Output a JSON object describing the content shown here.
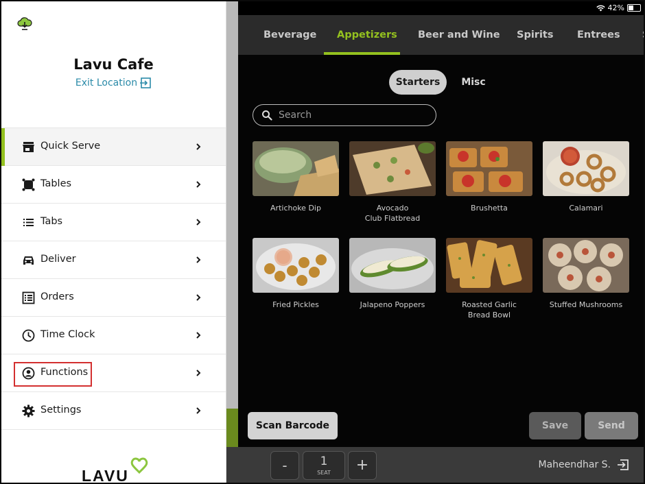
{
  "status": {
    "battery": "42%"
  },
  "categories": [
    "Beverage",
    "Appetizers",
    "Beer and Wine",
    "Spirits",
    "Entrees",
    "S"
  ],
  "active_category": "Appetizers",
  "subtabs": {
    "starters": "Starters",
    "misc": "Misc"
  },
  "search": {
    "placeholder": "Search"
  },
  "items": [
    {
      "line1": "Artichoke Dip",
      "line2": ""
    },
    {
      "line1": "Avocado",
      "line2": "Club Flatbread"
    },
    {
      "line1": "Brushetta",
      "line2": ""
    },
    {
      "line1": "Calamari",
      "line2": ""
    },
    {
      "line1": "Fried Pickles",
      "line2": ""
    },
    {
      "line1": "Jalapeno Poppers",
      "line2": ""
    },
    {
      "line1": "Roasted Garlic",
      "line2": "Bread Bowl"
    },
    {
      "line1": "Stuffed Mushrooms",
      "line2": ""
    }
  ],
  "actions": {
    "scan": "Scan Barcode",
    "save": "Save",
    "send": "Send"
  },
  "seat": {
    "minus": "-",
    "value": "1",
    "label": "SEAT",
    "plus": "+"
  },
  "user": "Maheendhar S.",
  "drawer": {
    "venue": "Lavu Cafe",
    "exit": "Exit Location",
    "menu": [
      {
        "label": "Quick Serve",
        "icon": "store-icon"
      },
      {
        "label": "Tables",
        "icon": "table-icon"
      },
      {
        "label": "Tabs",
        "icon": "list-icon"
      },
      {
        "label": "Deliver",
        "icon": "car-icon"
      },
      {
        "label": "Orders",
        "icon": "orders-icon"
      },
      {
        "label": "Time Clock",
        "icon": "clock-icon"
      },
      {
        "label": "Functions",
        "icon": "user-circle-icon"
      },
      {
        "label": "Settings",
        "icon": "gear-icon"
      }
    ],
    "logo_text": "LAVU"
  },
  "colors": {
    "accent": "#94c11f",
    "highlight": "#d32f2f",
    "link": "#2a8aa8"
  }
}
